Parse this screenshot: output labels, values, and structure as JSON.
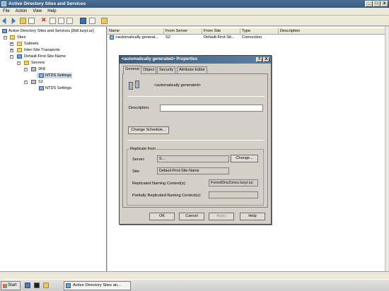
{
  "window": {
    "title": "Active Directory Sites and Services"
  },
  "menu": [
    "File",
    "Action",
    "View",
    "Help"
  ],
  "tree": {
    "root": "Active Directory Sites and Services [2k8.lusyi.sz]",
    "sites": "Sites",
    "subnets": "Subnets",
    "inter_site": "Inter-Site Transports",
    "default_site": "Default-First-Site-Name",
    "servers": "Servers",
    "server1": "2K8",
    "server1_ntds": "NTDS Settings",
    "server2": "S2",
    "server2_ntds": "NTDS Settings"
  },
  "list": {
    "columns": [
      "Name",
      "From Server",
      "From Site",
      "Type",
      "Description"
    ],
    "row": {
      "name": "<automatically generat...",
      "from_server": "S2",
      "from_site": "Default-First-Sit...",
      "type": "Connection",
      "description": ""
    }
  },
  "dialog": {
    "title": "<automatically generated> Properties",
    "help_btn": "?",
    "close_btn": "X",
    "tabs": [
      "General",
      "Object",
      "Security",
      "Attribute Editor"
    ],
    "object_name": "<automatically generated>",
    "description_label": "Description:",
    "description_value": "",
    "change_schedule": "Change Schedule...",
    "replicate_from": "Replicate from",
    "server_label": "Server:",
    "server_value": "S...",
    "change_btn": "Change...",
    "site_label": "Site:",
    "site_value": "Default-First-Site-Name",
    "replicated_nc_label": "Replicated Naming Context(s):",
    "replicated_nc_value": "ForestDnsZones.lusyi.sz;",
    "partial_nc_label": "Partially Replicated Naming Context(s):",
    "partial_nc_value": "",
    "ok": "OK",
    "cancel": "Cancel",
    "apply": "Apply",
    "help": "Help"
  },
  "taskbar": {
    "start": "Start",
    "task": "Active Directory Sites an..."
  },
  "colors": {
    "titlebar": "#3b5c80",
    "dialog_title": "#3c5e84",
    "selection": "#cfd8e6"
  }
}
